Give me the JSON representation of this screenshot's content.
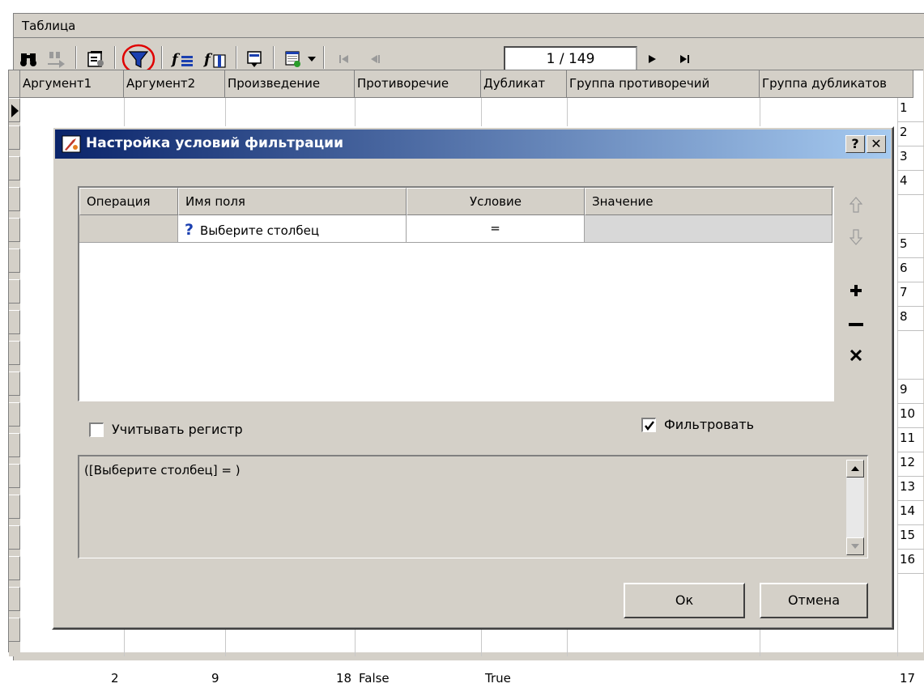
{
  "window": {
    "title": "Таблица"
  },
  "toolbar": {
    "page_counter": "1 / 149"
  },
  "grid": {
    "columns": [
      "Аргумент1",
      "Аргумент2",
      "Произведение",
      "Противоречие",
      "Дубликат",
      "Группа противоречий",
      "Группа дубликатов"
    ],
    "right_row_numbers": [
      "1",
      "2",
      "3",
      "4",
      "",
      "5",
      "6",
      "7",
      "8",
      "",
      "9",
      "10",
      "11",
      "12",
      "13",
      "14",
      "15",
      "16"
    ],
    "bottom_row": {
      "arg1": "2",
      "arg2": "9",
      "product": "18",
      "contradiction": "False",
      "duplicate": "True",
      "next": "17"
    }
  },
  "dialog": {
    "title": "Настройка условий фильтрации",
    "help_label": "?",
    "close_label": "✕",
    "table": {
      "headers": {
        "operation": "Операция",
        "field": "Имя поля",
        "condition": "Условие",
        "value": "Значение"
      },
      "row": {
        "operation": "",
        "field": "Выберите столбец",
        "condition": "=",
        "value": ""
      }
    },
    "case_sensitive_label": "Учитывать регистр",
    "case_sensitive_checked": false,
    "filter_label": "Фильтровать",
    "filter_checked": true,
    "expression": "([Выберите столбец] = )",
    "ok_label": "Ок",
    "cancel_label": "Отмена"
  }
}
